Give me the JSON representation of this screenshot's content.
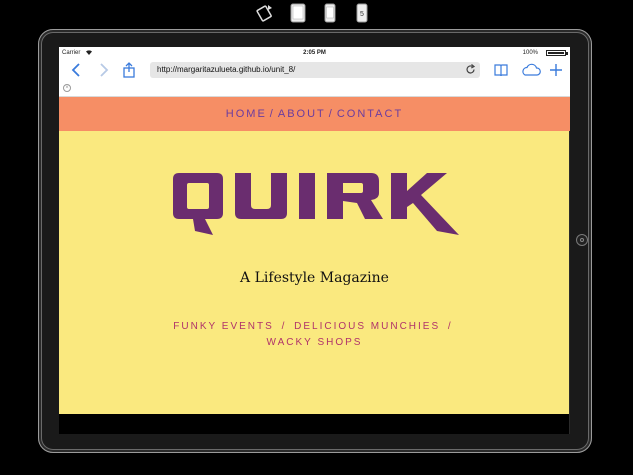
{
  "status": {
    "carrier": "Carrier",
    "time": "2:05 PM",
    "battery": "100%"
  },
  "browser": {
    "url": "http://margaritazulueta.github.io/unit_8/"
  },
  "site": {
    "nav": [
      {
        "label": "HOME"
      },
      {
        "label": "ABOUT"
      },
      {
        "label": "CONTACT"
      }
    ],
    "nav_separator": "/",
    "logo_text": "QUIRK",
    "tagline": "A Lifestyle Magazine",
    "categories": [
      {
        "label": "FUNKY EVENTS"
      },
      {
        "label": "DELICIOUS MUNCHIES"
      },
      {
        "label": "WACKY SHOPS"
      }
    ],
    "category_separator": "/"
  },
  "colors": {
    "nav_bg": "#f68e65",
    "hero_bg": "#fae97f",
    "logo": "#6a2d6f",
    "nav_text": "#6a3ca0",
    "category_text": "#b0336a",
    "ios_blue": "#3a7bdc"
  },
  "icons": {
    "rotate": "rotate-device-icon",
    "tablet": "tablet-icon",
    "phone": "phone-icon",
    "phone_small": "small-phone-icon",
    "back": "back-chevron-icon",
    "forward": "forward-chevron-icon",
    "share": "share-icon",
    "reload": "reload-icon",
    "reader": "reader-book-icon",
    "cloud": "icloud-tabs-icon",
    "new_tab": "plus-icon",
    "close_tab": "close-tab-icon"
  }
}
